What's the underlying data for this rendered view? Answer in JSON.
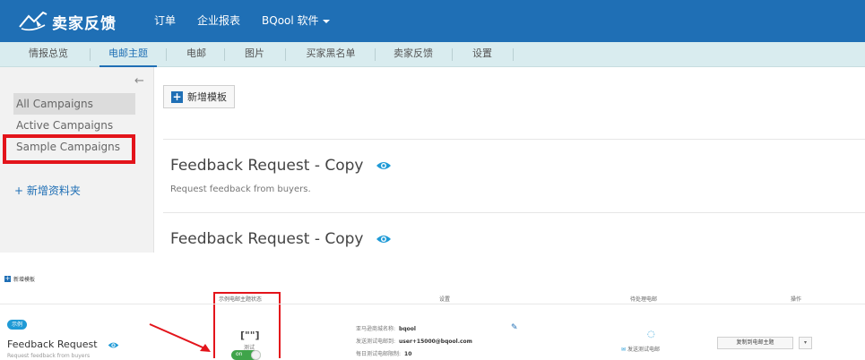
{
  "header": {
    "brand": "卖家反馈",
    "nav": [
      {
        "label": "订单"
      },
      {
        "label": "企业报表"
      },
      {
        "label": "BQool 软件"
      }
    ]
  },
  "subnav": {
    "items": [
      "情报总览",
      "电邮主题",
      "电邮",
      "图片",
      "买家黑名单",
      "卖家反馈",
      "设置"
    ],
    "active": "电邮主题"
  },
  "sidebar": {
    "items": [
      "All Campaigns",
      "Active Campaigns",
      "Sample Campaigns"
    ],
    "add_folder": "+ 新增资料夹"
  },
  "main": {
    "new_template": "新增模板",
    "cards": [
      {
        "title": "Feedback Request - Copy",
        "desc": "Request feedback from buyers."
      },
      {
        "title": "Feedback Request - Copy",
        "desc": ""
      }
    ]
  },
  "lower": {
    "new_template": "新增模板",
    "columns": [
      "示例电邮主题状态",
      "设置",
      "待处理电邮",
      "操作"
    ],
    "row": {
      "badge": "示例",
      "title": "Feedback Request",
      "desc": "Request feedback from buyers",
      "icon_text": "[\"\"]",
      "test_label": "测试",
      "toggle": "on",
      "settings": [
        {
          "label": "亚马逊商城名称:",
          "value": "bqool"
        },
        {
          "label": "发送测试电邮到:",
          "value": "user+15000@bqool.com"
        },
        {
          "label": "每日测试电邮限制:",
          "value": "10"
        }
      ],
      "send_test": "发送测试电邮",
      "copy_button": "复制到电邮主题",
      "copy_caret": "▾"
    }
  },
  "colors": {
    "brand_blue": "#1f6fb5",
    "subnav_bg": "#d9ecef",
    "highlight_red": "#e3141b",
    "toggle_green": "#3fa44a"
  }
}
